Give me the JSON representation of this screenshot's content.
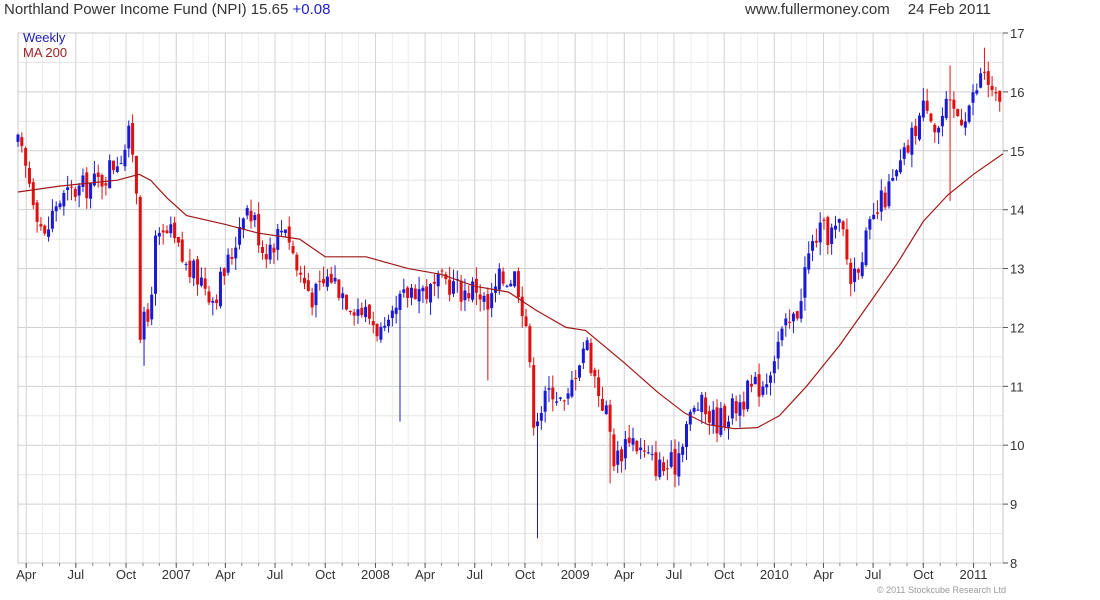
{
  "header": {
    "title": "Northland Power Income Fund (NPI) 15.65",
    "change": "+0.08",
    "site": "www.fullermoney.com",
    "date": "24 Feb 2011"
  },
  "copyright": "© 2011 Stockcube Research Ltd",
  "colors": {
    "up": "#1a1ad6",
    "down": "#e01010",
    "ma": "#a01818",
    "grid": "#dcdcdc"
  },
  "chart_data": {
    "type": "candlestick",
    "legend": [
      {
        "label": "Weekly",
        "color": "#2020b0"
      },
      {
        "label": "MA 200",
        "color": "#a02020"
      }
    ],
    "ylim": [
      8,
      17
    ],
    "y_ticks": [
      "8",
      "9",
      "10",
      "11",
      "12",
      "13",
      "14",
      "15",
      "16",
      "17"
    ],
    "x_start": "2006-03-17",
    "x_end": "2011-02-24",
    "x_ticks": [
      {
        "label": "Apr",
        "date": "2006-04-01"
      },
      {
        "label": "Jul",
        "date": "2006-07-01"
      },
      {
        "label": "Oct",
        "date": "2006-10-01"
      },
      {
        "label": "2007",
        "date": "2007-01-01"
      },
      {
        "label": "Apr",
        "date": "2007-04-01"
      },
      {
        "label": "Jul",
        "date": "2007-07-01"
      },
      {
        "label": "Oct",
        "date": "2007-10-01"
      },
      {
        "label": "2008",
        "date": "2008-01-01"
      },
      {
        "label": "Apr",
        "date": "2008-04-01"
      },
      {
        "label": "Jul",
        "date": "2008-07-01"
      },
      {
        "label": "Oct",
        "date": "2008-10-01"
      },
      {
        "label": "2009",
        "date": "2009-01-01"
      },
      {
        "label": "Apr",
        "date": "2009-04-01"
      },
      {
        "label": "Jul",
        "date": "2009-07-01"
      },
      {
        "label": "Oct",
        "date": "2009-10-01"
      },
      {
        "label": "2010",
        "date": "2010-01-01"
      },
      {
        "label": "Apr",
        "date": "2010-04-01"
      },
      {
        "label": "Jul",
        "date": "2010-07-01"
      },
      {
        "label": "Oct",
        "date": "2010-10-01"
      },
      {
        "label": "2011",
        "date": "2011-01-01"
      }
    ],
    "price_path": [
      [
        "2006-03-17",
        15.1
      ],
      [
        "2006-04-10",
        14.4
      ],
      [
        "2006-05-05",
        13.5
      ],
      [
        "2006-05-25",
        14.1
      ],
      [
        "2006-06-25",
        14.3
      ],
      [
        "2006-08-15",
        14.5
      ],
      [
        "2006-09-25",
        15.0
      ],
      [
        "2006-10-10",
        15.3
      ],
      [
        "2006-10-20",
        14.4
      ],
      [
        "2006-10-27",
        12.0
      ],
      [
        "2006-11-10",
        12.1
      ],
      [
        "2006-11-24",
        13.4
      ],
      [
        "2006-12-20",
        13.6
      ],
      [
        "2007-01-20",
        13.0
      ],
      [
        "2007-02-20",
        12.8
      ],
      [
        "2007-03-10",
        12.5
      ],
      [
        "2007-04-15",
        13.3
      ],
      [
        "2007-05-05",
        14.1
      ],
      [
        "2007-05-25",
        13.8
      ],
      [
        "2007-06-10",
        13.3
      ],
      [
        "2007-07-01",
        13.5
      ],
      [
        "2007-07-20",
        13.8
      ],
      [
        "2007-08-10",
        13.0
      ],
      [
        "2007-09-10",
        12.5
      ],
      [
        "2007-10-10",
        12.9
      ],
      [
        "2007-11-10",
        12.5
      ],
      [
        "2007-12-20",
        12.2
      ],
      [
        "2008-01-20",
        11.8
      ],
      [
        "2008-02-15",
        12.4
      ],
      [
        "2008-03-10",
        12.7
      ],
      [
        "2008-04-10",
        12.6
      ],
      [
        "2008-05-10",
        12.8
      ],
      [
        "2008-06-10",
        12.6
      ],
      [
        "2008-07-05",
        12.7
      ],
      [
        "2008-07-25",
        12.3
      ],
      [
        "2008-08-15",
        12.8
      ],
      [
        "2008-09-15",
        12.9
      ],
      [
        "2008-10-05",
        12.0
      ],
      [
        "2008-10-15",
        10.5
      ],
      [
        "2008-10-29",
        10.6
      ],
      [
        "2008-11-20",
        11.0
      ],
      [
        "2008-12-15",
        10.6
      ],
      [
        "2009-01-01",
        11.3
      ],
      [
        "2009-01-20",
        11.8
      ],
      [
        "2009-02-10",
        11.0
      ],
      [
        "2009-03-01",
        10.5
      ],
      [
        "2009-03-15",
        9.7
      ],
      [
        "2009-04-10",
        10.2
      ],
      [
        "2009-05-10",
        9.8
      ],
      [
        "2009-06-10",
        9.6
      ],
      [
        "2009-07-05",
        9.7
      ],
      [
        "2009-07-20",
        10.3
      ],
      [
        "2009-08-15",
        10.7
      ],
      [
        "2009-09-15",
        10.4
      ],
      [
        "2009-10-15",
        10.6
      ],
      [
        "2009-11-15",
        10.9
      ],
      [
        "2009-12-15",
        11.1
      ],
      [
        "2010-01-10",
        11.8
      ],
      [
        "2010-02-10",
        12.2
      ],
      [
        "2010-03-01",
        13.1
      ],
      [
        "2010-03-20",
        13.6
      ],
      [
        "2010-04-15",
        13.6
      ],
      [
        "2010-05-05",
        13.7
      ],
      [
        "2010-05-20",
        12.8
      ],
      [
        "2010-06-15",
        13.4
      ],
      [
        "2010-07-15",
        14.1
      ],
      [
        "2010-08-10",
        14.5
      ],
      [
        "2010-09-01",
        15.0
      ],
      [
        "2010-09-20",
        15.5
      ],
      [
        "2010-10-10",
        15.9
      ],
      [
        "2010-10-25",
        15.3
      ],
      [
        "2010-11-10",
        15.7
      ],
      [
        "2010-12-10",
        15.6
      ],
      [
        "2011-01-01",
        15.9
      ],
      [
        "2011-01-20",
        16.4
      ],
      [
        "2011-02-05",
        15.9
      ],
      [
        "2011-02-24",
        15.65
      ]
    ],
    "spikes": [
      {
        "date": "2006-11-03",
        "low": 11.35
      },
      {
        "date": "2008-02-15",
        "low": 10.4
      },
      {
        "date": "2008-07-22",
        "low": 11.1
      },
      {
        "date": "2008-10-24",
        "low": 8.42
      },
      {
        "date": "2009-03-05",
        "low": 9.35
      },
      {
        "date": "2010-11-20",
        "high": 16.45,
        "low": 14.15
      },
      {
        "date": "2011-01-18",
        "high": 16.75
      }
    ],
    "ma200_path": [
      [
        "2006-03-17",
        14.3
      ],
      [
        "2006-06-01",
        14.4
      ],
      [
        "2006-09-15",
        14.5
      ],
      [
        "2006-10-25",
        14.6
      ],
      [
        "2006-11-15",
        14.5
      ],
      [
        "2006-12-15",
        14.2
      ],
      [
        "2007-01-20",
        13.9
      ],
      [
        "2007-04-01",
        13.75
      ],
      [
        "2007-06-01",
        13.6
      ],
      [
        "2007-08-15",
        13.5
      ],
      [
        "2007-10-01",
        13.2
      ],
      [
        "2007-12-15",
        13.2
      ],
      [
        "2008-03-01",
        13.0
      ],
      [
        "2008-05-01",
        12.9
      ],
      [
        "2008-07-01",
        12.7
      ],
      [
        "2008-09-01",
        12.6
      ],
      [
        "2008-10-20",
        12.3
      ],
      [
        "2008-12-15",
        12.0
      ],
      [
        "2009-01-20",
        11.95
      ],
      [
        "2009-04-01",
        11.4
      ],
      [
        "2009-06-01",
        10.9
      ],
      [
        "2009-07-20",
        10.55
      ],
      [
        "2009-09-01",
        10.35
      ],
      [
        "2009-10-20",
        10.28
      ],
      [
        "2009-12-01",
        10.3
      ],
      [
        "2010-01-10",
        10.5
      ],
      [
        "2010-03-01",
        11.0
      ],
      [
        "2010-05-01",
        11.7
      ],
      [
        "2010-07-01",
        12.5
      ],
      [
        "2010-08-15",
        13.1
      ],
      [
        "2010-10-01",
        13.8
      ],
      [
        "2010-11-15",
        14.25
      ],
      [
        "2011-01-01",
        14.6
      ],
      [
        "2011-02-24",
        14.95
      ]
    ]
  }
}
